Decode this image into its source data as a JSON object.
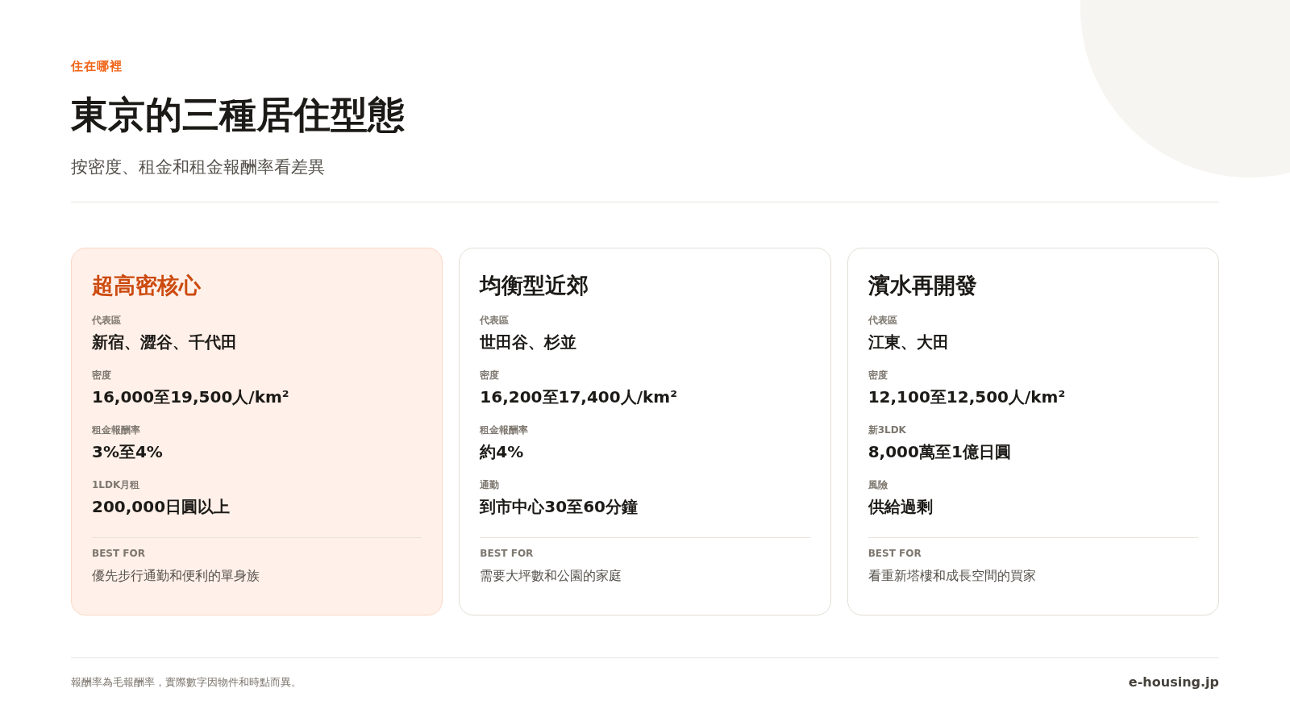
{
  "eyebrow": "住在哪裡",
  "title": "東京的三種居住型態",
  "subtitle": "按密度、租金和租金報酬率看差異",
  "cards": [
    {
      "title": "超高密核心",
      "highlighted": true,
      "facts": [
        {
          "label": "代表區",
          "value": "新宿、澀谷、千代田"
        },
        {
          "label": "密度",
          "value": "16,000至19,500人/km²"
        },
        {
          "label": "租金報酬率",
          "value": "3%至4%"
        },
        {
          "label": "1LDK月租",
          "value": "200,000日圓以上"
        }
      ],
      "best_for_label": "BEST FOR",
      "best_for": "優先步行通勤和便利的單身族"
    },
    {
      "title": "均衡型近郊",
      "highlighted": false,
      "facts": [
        {
          "label": "代表區",
          "value": "世田谷、杉並"
        },
        {
          "label": "密度",
          "value": "16,200至17,400人/km²"
        },
        {
          "label": "租金報酬率",
          "value": "約4%"
        },
        {
          "label": "通勤",
          "value": "到市中心30至60分鐘"
        }
      ],
      "best_for_label": "BEST FOR",
      "best_for": "需要大坪數和公園的家庭"
    },
    {
      "title": "濱水再開發",
      "highlighted": false,
      "facts": [
        {
          "label": "代表區",
          "value": "江東、大田"
        },
        {
          "label": "密度",
          "value": "12,100至12,500人/km²"
        },
        {
          "label": "新3LDK",
          "value": "8,000萬至1億日圓"
        },
        {
          "label": "風險",
          "value": "供給過剩"
        }
      ],
      "best_for_label": "BEST FOR",
      "best_for": "看重新塔樓和成長空間的買家"
    }
  ],
  "footer": {
    "note": "報酬率為毛報酬率，實際數字因物件和時點而異。",
    "site": "e-housing.jp"
  }
}
